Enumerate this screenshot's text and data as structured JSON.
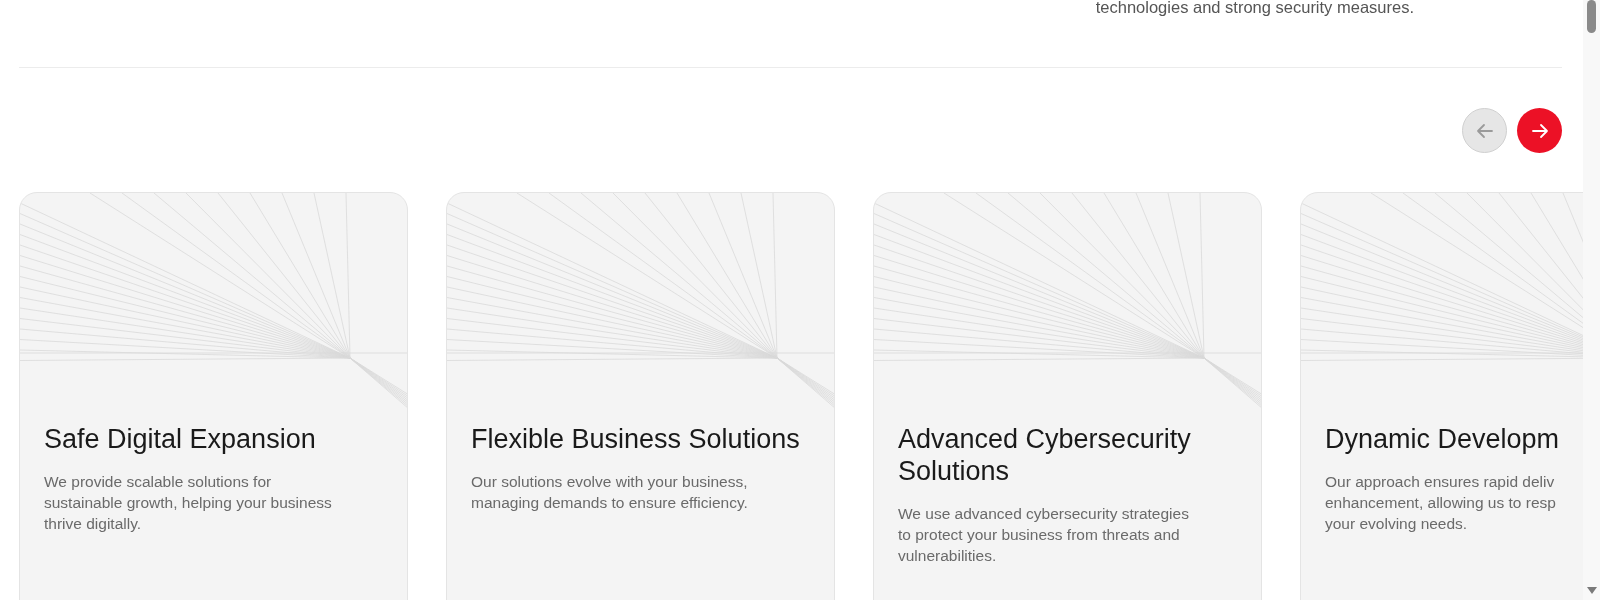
{
  "intro": "technologies and strong security measures.",
  "carousel_controls": [
    {
      "kind": "prev",
      "disabled": true
    },
    {
      "kind": "next",
      "disabled": false
    }
  ],
  "cards": [
    {
      "title": "Safe Digital Expansion",
      "description": [
        "We provide scalable solutions for",
        "sustainable growth, helping your business",
        "thrive digitally."
      ]
    },
    {
      "title": "Flexible Business Solutions",
      "description": [
        "Our solutions evolve with your business,",
        "managing demands to ensure efficiency."
      ]
    },
    {
      "title": "Advanced Cybersecurity Solutions",
      "description": [
        "We use advanced cybersecurity strategies",
        "to protect your business from threats and",
        "vulnerabilities."
      ]
    },
    {
      "title": "Dynamic Developm",
      "description": [
        "Our approach ensures rapid deliv",
        "enhancement, allowing us to resp",
        "your evolving needs."
      ]
    }
  ]
}
